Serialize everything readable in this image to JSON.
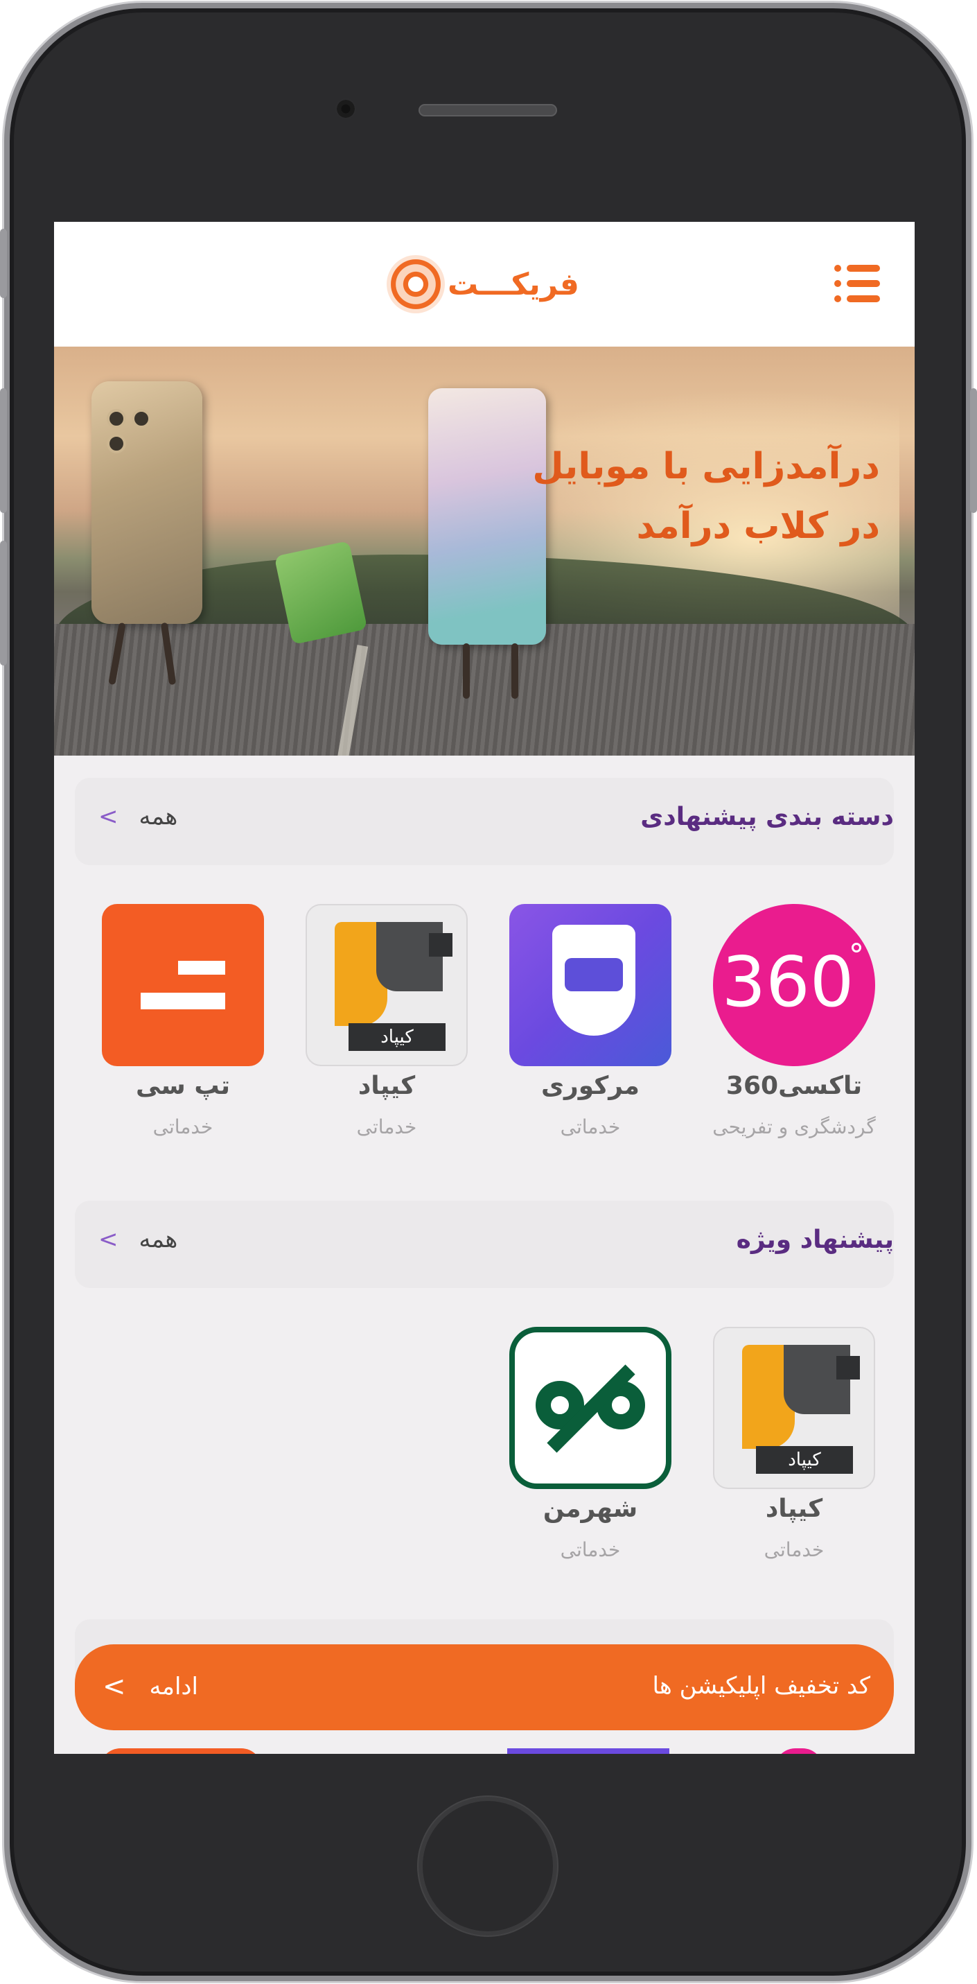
{
  "app": {
    "brand_name": "فریکـــت",
    "accent_color": "#f06a23",
    "title_color": "#5a2c81"
  },
  "banner": {
    "line1": "درآمدزایی با موبایل",
    "line2": "در کلاب درآمد"
  },
  "sections": [
    {
      "title": "دسته بندی پیشنهادی",
      "see_all": "همه",
      "apps": [
        {
          "name": "تاکسی360",
          "category": "گردشگری و تفریحی",
          "icon": "taxi360-icon",
          "icon_text": "360"
        },
        {
          "name": "مرکوری",
          "category": "خدماتی",
          "icon": "mercury-icon"
        },
        {
          "name": "کیپاد",
          "category": "خدماتی",
          "icon": "kipad-icon",
          "icon_text": "کیپاد"
        },
        {
          "name": "تپ سی",
          "category": "خدماتی",
          "icon": "tapsi-icon"
        }
      ]
    },
    {
      "title": "پیشنهاد ویژه",
      "see_all": "همه",
      "apps": [
        {
          "name": "کیپاد",
          "category": "خدماتی",
          "icon": "kipad-icon",
          "icon_text": "کیپاد"
        },
        {
          "name": "شهرمن",
          "category": "خدماتی",
          "icon": "shahrman-icon"
        }
      ]
    }
  ],
  "cta": {
    "title": "کد تخفیف اپلیکیشن ها",
    "action": "ادامه"
  }
}
